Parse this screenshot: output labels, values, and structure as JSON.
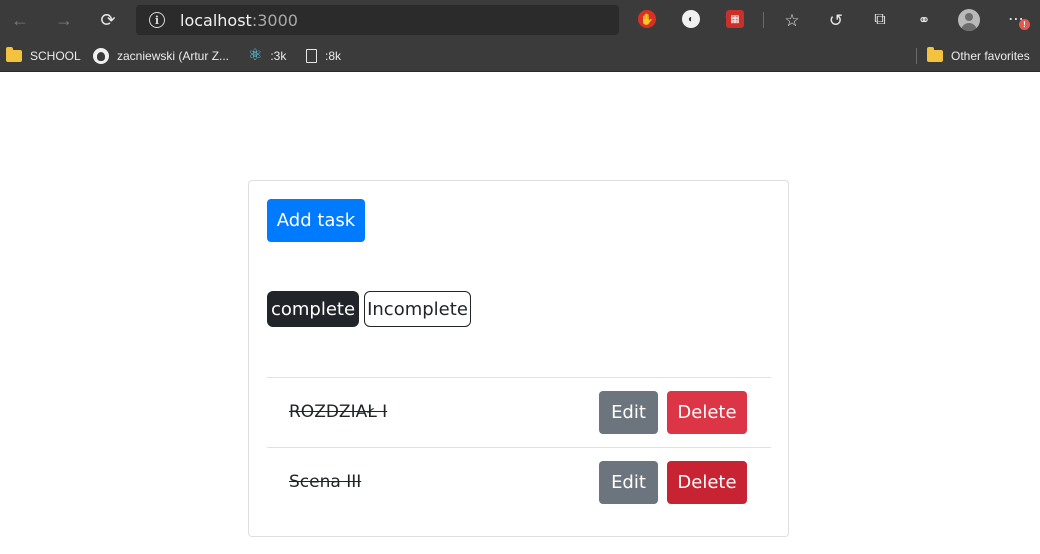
{
  "browser": {
    "url_host": "localhost",
    "url_port": ":3000",
    "bookmarks": [
      {
        "label": "SCHOOL",
        "icon": "folder-icon"
      },
      {
        "label": "zacniewski (Artur Z...",
        "icon": "github-icon"
      },
      {
        "label": ":3k",
        "icon": "react-icon"
      },
      {
        "label": ":8k",
        "icon": "page-icon"
      }
    ],
    "other_favorites": "Other favorites",
    "notification_badge": "!"
  },
  "app": {
    "add_task_label": "Add task",
    "filters": {
      "complete_label": "complete",
      "incomplete_label": "Incomplete",
      "active": "complete"
    },
    "tasks": [
      {
        "title": "ROZDZIAŁ I",
        "completed": true,
        "edit_label": "Edit",
        "delete_label": "Delete"
      },
      {
        "title": "Scena III",
        "completed": true,
        "edit_label": "Edit",
        "delete_label": "Delete"
      }
    ]
  },
  "colors": {
    "primary": "#007bff",
    "dark": "#212529",
    "secondary": "#6c757d",
    "danger": "#dc3545",
    "browser_chrome": "#3b3b3b"
  }
}
